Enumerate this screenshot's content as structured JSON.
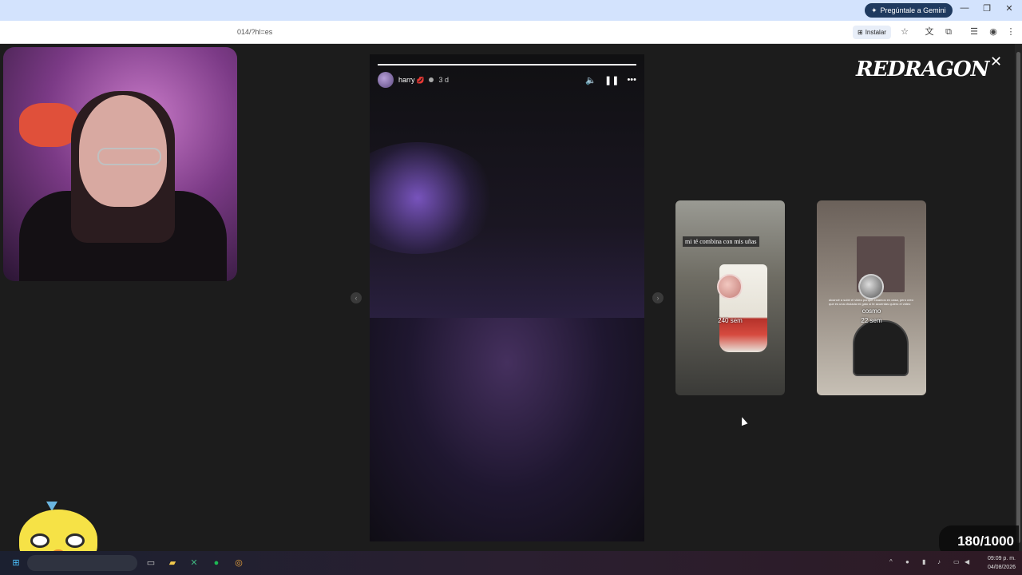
{
  "browser": {
    "gemini_label": "Pregúntale a Gemini",
    "url_fragment": "014/?hl=es",
    "install_label": "Instalar",
    "window_controls": [
      "—",
      "❐",
      "✕"
    ],
    "toolbar_icons": [
      "star-icon",
      "translate-icon",
      "extensions-icon",
      "media-icon",
      "profile-icon",
      "menu-icon"
    ]
  },
  "story": {
    "username": "harry",
    "emoji": "💋",
    "age": "3 d",
    "progress": 1.0,
    "controls": [
      "volume-icon",
      "pause-icon",
      "more-icon"
    ]
  },
  "thumbnails": [
    {
      "caption": "mi té combina con mis uñas",
      "time": "240 sem"
    },
    {
      "username": "cosmo",
      "time": "22 sem",
      "caption_small": "alcancé a subir el video porque estamos en casa, pero creo que es una chulada mi gato si te acuerdas quiero el video"
    }
  ],
  "brand": {
    "logo_text": "REDRAGON"
  },
  "overlay": {
    "counter": "180/1000"
  },
  "taskbar": {
    "time": "09:09 p. m.",
    "date": "04/08/2026"
  },
  "colors": {
    "chrome_top": "#d3e3fd",
    "viewport_bg": "#1c1c1c",
    "accent_purple": "#7b3a86",
    "chick_yellow": "#f6e246"
  }
}
